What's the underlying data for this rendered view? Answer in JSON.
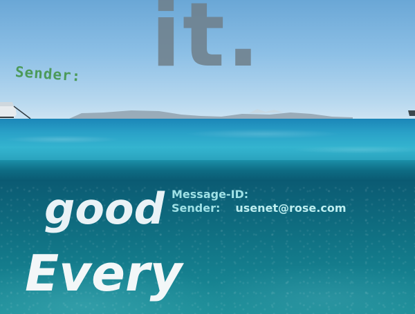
{
  "overlay": {
    "sender_label_top": "Sender:",
    "word_it": "it.",
    "message_id_label": "Message-ID:",
    "sender_label": "Sender:",
    "sender_value": "usenet@rose.com",
    "word_good": "good",
    "word_every": "Every"
  },
  "colors": {
    "sky": "#8dc0e6",
    "sea_surface": "#2aa2c8",
    "underwater": "#0f6d80",
    "sender_top_text": "#4c9a5a",
    "it_text": "#6f7f8a",
    "header_text": "#9fe1e6",
    "caption_text": "#f3f7f8"
  }
}
